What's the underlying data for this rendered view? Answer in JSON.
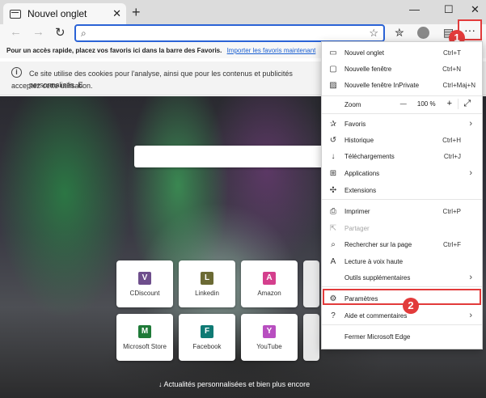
{
  "tab": {
    "title": "Nouvel onglet"
  },
  "window": {
    "minimize": "—",
    "maximize": "☐",
    "close": "✕"
  },
  "address": {
    "value": "",
    "placeholder": ""
  },
  "favorites_bar": {
    "text": "Pour un accès rapide, placez vos favoris ici dans la barre des Favoris.",
    "link": "Importer les favoris maintenant"
  },
  "cookie_bar": {
    "text_line1": "Ce site utilise des cookies pour l'analyse, ainsi que pour les contenus et publicités personnalisés. E",
    "text_line2": "acceptez cette utilisation."
  },
  "tiles": [
    {
      "letter": "V",
      "label": "CDiscount",
      "color": "#6e4e8c"
    },
    {
      "letter": "L",
      "label": "Linkedin",
      "color": "#6b6a34"
    },
    {
      "letter": "A",
      "label": "Amazon",
      "color": "#d43f8d"
    },
    {
      "letter": "M",
      "label": "Microsoft Store",
      "color": "#1f7a38"
    },
    {
      "letter": "F",
      "label": "Facebook",
      "color": "#0f7a74"
    },
    {
      "letter": "Y",
      "label": "YouTube",
      "color": "#b84fc0"
    }
  ],
  "news_bar": "↓  Actualités personnalisées et bien plus encore",
  "menu": {
    "new_tab": {
      "label": "Nouvel onglet",
      "shortcut": "Ctrl+T"
    },
    "new_window": {
      "label": "Nouvelle fenêtre",
      "shortcut": "Ctrl+N"
    },
    "new_inprivate": {
      "label": "Nouvelle fenêtre InPrivate",
      "shortcut": "Ctrl+Maj+N"
    },
    "zoom": {
      "label": "Zoom",
      "minus": "—",
      "value": "100 %",
      "plus": "+",
      "fullscreen": "⤢"
    },
    "favorites": {
      "label": "Favoris"
    },
    "history": {
      "label": "Historique",
      "shortcut": "Ctrl+H"
    },
    "downloads": {
      "label": "Téléchargements",
      "shortcut": "Ctrl+J"
    },
    "apps": {
      "label": "Applications"
    },
    "extensions": {
      "label": "Extensions"
    },
    "print": {
      "label": "Imprimer",
      "shortcut": "Ctrl+P"
    },
    "share": {
      "label": "Partager"
    },
    "find": {
      "label": "Rechercher sur la page",
      "shortcut": "Ctrl+F"
    },
    "read_aloud": {
      "label": "Lecture à voix haute"
    },
    "more_tools": {
      "label": "Outils supplémentaires"
    },
    "settings": {
      "label": "Paramètres"
    },
    "help": {
      "label": "Aide et commentaires"
    },
    "close": {
      "label": "Fermer Microsoft Edge"
    }
  },
  "badges": {
    "one": "1",
    "two": "2"
  },
  "colors": {
    "accent": "#2b63d6",
    "highlight": "#e23b3b"
  }
}
